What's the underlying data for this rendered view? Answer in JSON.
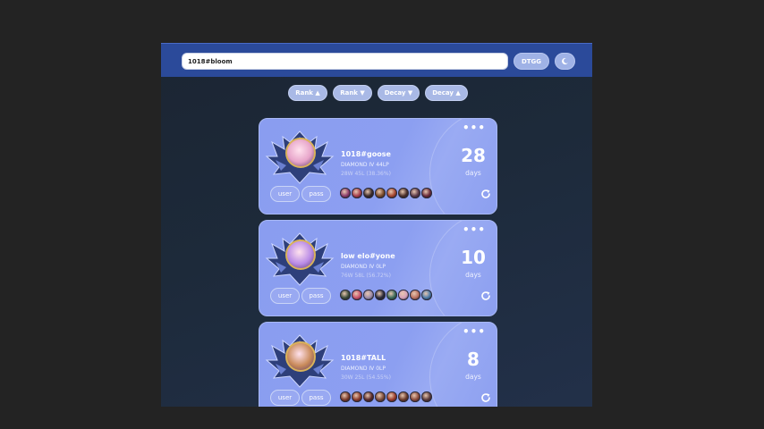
{
  "search": {
    "value": "1018#bloom"
  },
  "topbar": {
    "dtgg_label": "DTGG",
    "theme_icon": "moon-icon"
  },
  "sort_buttons": [
    {
      "label": "Rank ▲"
    },
    {
      "label": "Rank ▼"
    },
    {
      "label": "Decay ▼"
    },
    {
      "label": "Decay ▲"
    }
  ],
  "cards": [
    {
      "name": "1018#goose",
      "rank": "DIAMOND IV 44LP",
      "winloss": "28W 45L (38.36%)",
      "days": "28",
      "days_label": "days",
      "user_label": "user",
      "pass_label": "pass",
      "portrait_color": "#e7a4c9",
      "champ_colors": [
        "#8a3b6b",
        "#a63d4c",
        "#3a2a2a",
        "#7a4a2a",
        "#a5452f",
        "#4a2f2a",
        "#5a3a4a",
        "#6a2a3a"
      ]
    },
    {
      "name": "low elo#yone",
      "rank": "DIAMOND IV 0LP",
      "winloss": "76W 58L (56.72%)",
      "days": "10",
      "days_label": "days",
      "user_label": "user",
      "pass_label": "pass",
      "portrait_color": "#b98be6",
      "champ_colors": [
        "#3a4a3a",
        "#c7506a",
        "#9a8aa8",
        "#2a2a3a",
        "#3a6a5a",
        "#d5a0b8",
        "#b87060",
        "#4a7aa8"
      ]
    },
    {
      "name": "1018#TALL",
      "rank": "DIAMOND IV 0LP",
      "winloss": "30W 25L (54.55%)",
      "days": "8",
      "days_label": "days",
      "user_label": "user",
      "pass_label": "pass",
      "portrait_color": "#c98a5a",
      "champ_colors": [
        "#7a3a2a",
        "#8a3a2a",
        "#5a2a2a",
        "#7a4a3a",
        "#9a3a2a",
        "#6a3a2a",
        "#8a4a3a",
        "#5a3a3a"
      ]
    }
  ]
}
